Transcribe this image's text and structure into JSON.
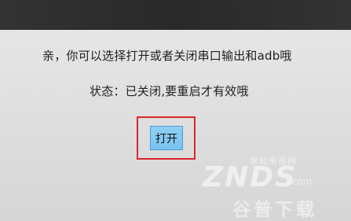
{
  "dialog": {
    "message": "亲，你可以选择打开或者关闭串口输出和adb哦",
    "status": "状态：已关闭,要重启才有效哦",
    "open_button": "打开",
    "highlight_color": "#d8262d"
  },
  "watermark": {
    "brand": "智能电视网",
    "logo": "ZNDS",
    "domain": ".com",
    "site": "谷普下载"
  }
}
